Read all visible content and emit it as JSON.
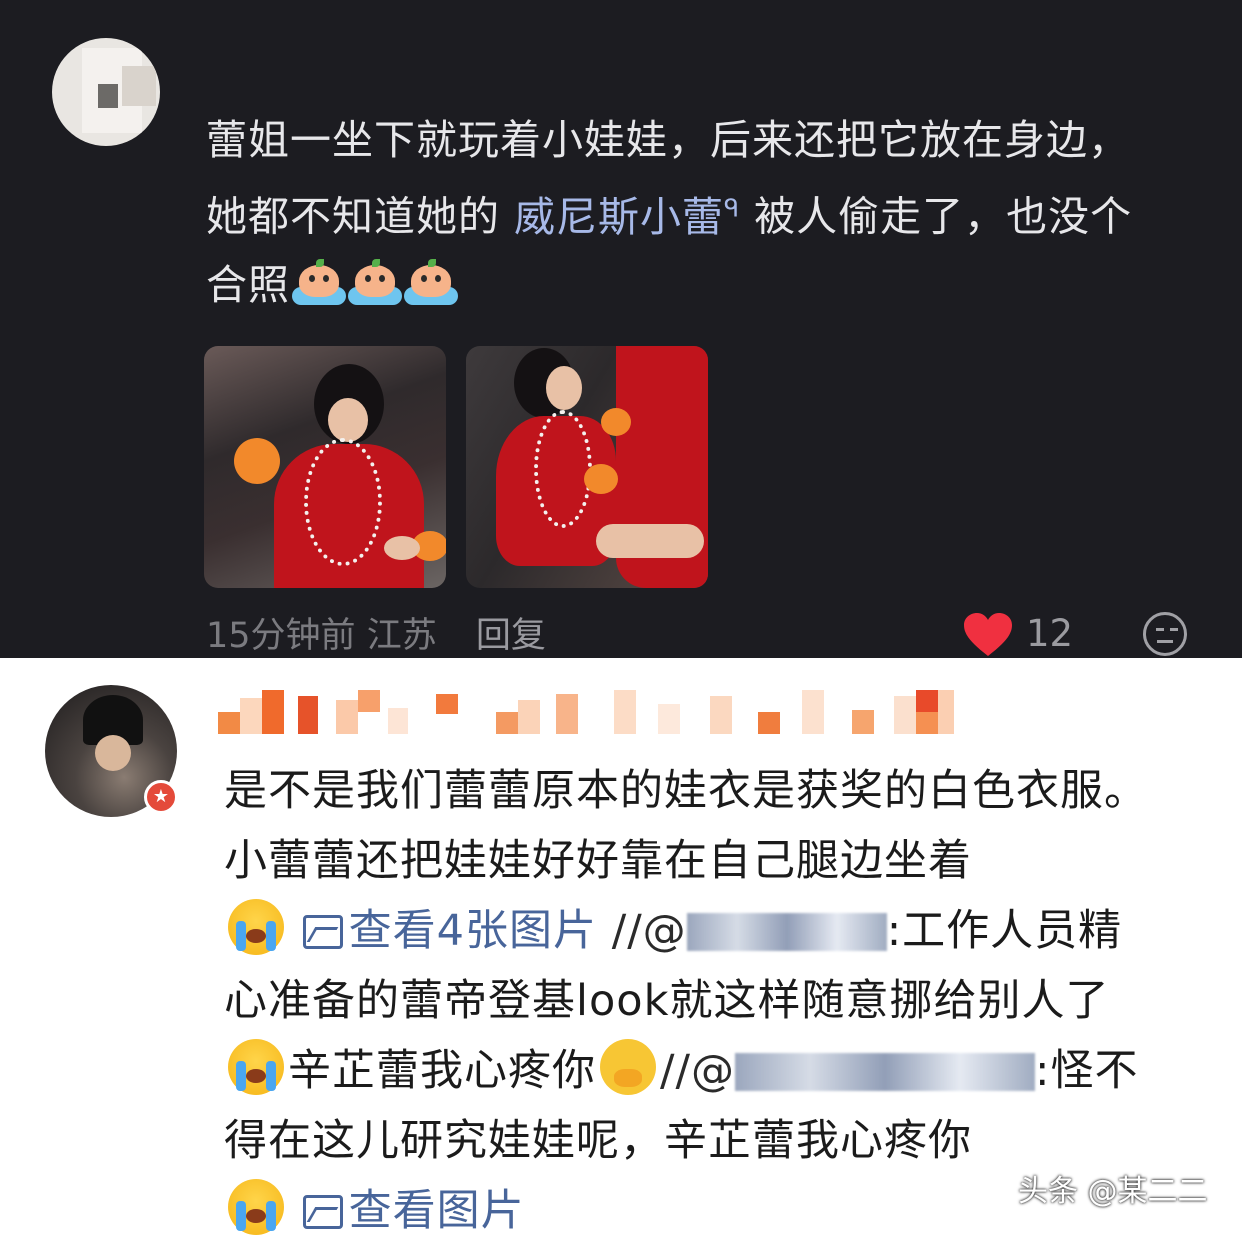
{
  "comment1": {
    "text_before_link": "蕾姐一坐下就玩着小娃娃，后来还把它放在身边，她都不知道她的 ",
    "link_text": "威尼斯小蕾",
    "link_search_glyph": "ᑫ",
    "text_after_link": " 被人偷走了，也没个合照",
    "emojis": [
      "crying-orange-icon",
      "crying-orange-icon",
      "crying-orange-icon"
    ],
    "meta": {
      "time": "15分钟前",
      "location": "江苏",
      "reply_label": "回复"
    },
    "likes": "12",
    "colors": {
      "background": "#1c1c21",
      "text": "#e7e7ea",
      "link": "#a7b9e8",
      "heart": "#f03040"
    }
  },
  "comment2": {
    "line_part1": "是不是我们蕾蕾原本的娃衣是获奖的白色衣服。小蕾蕾还把娃娃好好靠在自己腿边坐着",
    "view_images_label_1": "查看4张图片",
    "mention_1_prefix": "//@",
    "mention_1_suffix": ":工作人员精心准备的蕾帝登基look就这样随意挪给别人了",
    "text_2": "辛芷蕾我心疼你",
    "mention_2_prefix": "//@",
    "mention_2_suffix": ":",
    "text_3": "怪不得在这儿研究娃娃呢，辛芷蕾我心疼你",
    "view_images_label_2": "查看图片",
    "colors": {
      "text": "#1b1b1b",
      "link": "#48659a",
      "badge": "#e44a3a"
    }
  },
  "watermark": "头条 @某二二"
}
